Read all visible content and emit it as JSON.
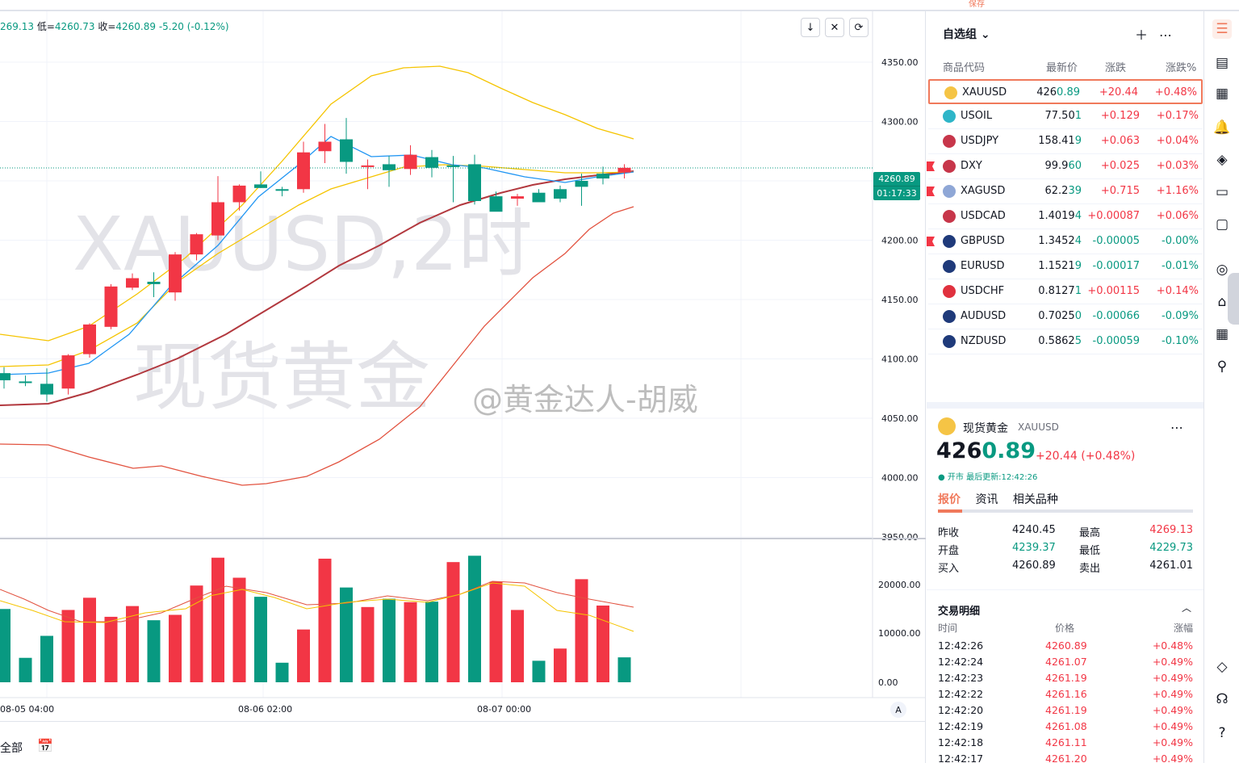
{
  "header": {
    "ohlc_text_prefix": "269.13 ",
    "low_label": "低=",
    "low_value": "4260.73",
    "close_label": "收=",
    "close_value": "4260.89",
    "change": "-5.20 (-0.12%)",
    "save_label": "保存"
  },
  "chart_tools": [
    "↓",
    "✕",
    "⟳"
  ],
  "watermark": {
    "line1": "XAUUSD,2时",
    "line2": "现货黄金",
    "weibo": "@黄金达人-胡威"
  },
  "price_tag": {
    "price": "4260.89",
    "countdown": "01:17:33"
  },
  "colors": {
    "up": "#f23645",
    "down": "#089981",
    "accent": "#f0795b",
    "ma_blue": "#2196f3",
    "ma_yellow": "#f5c400",
    "ma_red": "#b2383e",
    "band_red": "#e2523f"
  },
  "chart_data": {
    "type": "candlestick",
    "title": "XAUUSD,2时",
    "ylim": [
      3950,
      4350
    ],
    "y_ticks": [
      "4350.00",
      "4300.00",
      "4250.00",
      "4200.00",
      "4150.00",
      "4100.00",
      "4050.00",
      "4000.00",
      "3950.00"
    ],
    "x_ticks": [
      "08-05 04:00",
      "08-06 02:00",
      "08-07 00:00"
    ],
    "candles": [
      {
        "o": 4088,
        "h": 4093,
        "l": 4075,
        "c": 4082
      },
      {
        "o": 4081,
        "h": 4086,
        "l": 4077,
        "c": 4080
      },
      {
        "o": 4079,
        "h": 4092,
        "l": 4064,
        "c": 4070
      },
      {
        "o": 4075,
        "h": 4104,
        "l": 4070,
        "c": 4103
      },
      {
        "o": 4104,
        "h": 4130,
        "l": 4101,
        "c": 4129
      },
      {
        "o": 4127,
        "h": 4163,
        "l": 4125,
        "c": 4161
      },
      {
        "o": 4160,
        "h": 4172,
        "l": 4158,
        "c": 4168
      },
      {
        "o": 4165,
        "h": 4173,
        "l": 4152,
        "c": 4163
      },
      {
        "o": 4156,
        "h": 4190,
        "l": 4149,
        "c": 4188
      },
      {
        "o": 4188,
        "h": 4206,
        "l": 4183,
        "c": 4205
      },
      {
        "o": 4204,
        "h": 4254,
        "l": 4200,
        "c": 4232
      },
      {
        "o": 4232,
        "h": 4247,
        "l": 4225,
        "c": 4246
      },
      {
        "o": 4247,
        "h": 4258,
        "l": 4244,
        "c": 4244
      },
      {
        "o": 4243,
        "h": 4245,
        "l": 4237,
        "c": 4242
      },
      {
        "o": 4243,
        "h": 4283,
        "l": 4240,
        "c": 4274
      },
      {
        "o": 4275,
        "h": 4298,
        "l": 4265,
        "c": 4283
      },
      {
        "o": 4285,
        "h": 4303,
        "l": 4256,
        "c": 4266
      },
      {
        "o": 4262,
        "h": 4268,
        "l": 4243,
        "c": 4263
      },
      {
        "o": 4264,
        "h": 4271,
        "l": 4245,
        "c": 4259
      },
      {
        "o": 4260,
        "h": 4280,
        "l": 4255,
        "c": 4272
      },
      {
        "o": 4270,
        "h": 4276,
        "l": 4253,
        "c": 4261
      },
      {
        "o": 4263,
        "h": 4271,
        "l": 4232,
        "c": 4262
      },
      {
        "o": 4264,
        "h": 4272,
        "l": 4230,
        "c": 4233
      },
      {
        "o": 4237,
        "h": 4241,
        "l": 4225,
        "c": 4224
      },
      {
        "o": 4235,
        "h": 4239,
        "l": 4229,
        "c": 4237
      },
      {
        "o": 4240,
        "h": 4243,
        "l": 4234,
        "c": 4232
      },
      {
        "o": 4243,
        "h": 4246,
        "l": 4232,
        "c": 4235
      },
      {
        "o": 4250,
        "h": 4256,
        "l": 4229,
        "c": 4245
      },
      {
        "o": 4256,
        "h": 4262,
        "l": 4247,
        "c": 4252
      },
      {
        "o": 4257,
        "h": 4264,
        "l": 4252,
        "c": 4261
      }
    ],
    "volume_ticks": [
      "20000.00",
      "10000.00",
      "0.00"
    ],
    "volumes": [
      {
        "v": 15000,
        "up": false
      },
      {
        "v": 5000,
        "up": false
      },
      {
        "v": 9500,
        "up": false
      },
      {
        "v": 14800,
        "up": true
      },
      {
        "v": 17300,
        "up": true
      },
      {
        "v": 13400,
        "up": true
      },
      {
        "v": 15600,
        "up": true
      },
      {
        "v": 12700,
        "up": false
      },
      {
        "v": 13800,
        "up": true
      },
      {
        "v": 19800,
        "up": true
      },
      {
        "v": 25500,
        "up": true
      },
      {
        "v": 21400,
        "up": true
      },
      {
        "v": 17500,
        "up": false
      },
      {
        "v": 4000,
        "up": false
      },
      {
        "v": 10800,
        "up": true
      },
      {
        "v": 25300,
        "up": true
      },
      {
        "v": 19400,
        "up": false
      },
      {
        "v": 15400,
        "up": true
      },
      {
        "v": 17100,
        "up": false
      },
      {
        "v": 16400,
        "up": true
      },
      {
        "v": 16500,
        "up": false
      },
      {
        "v": 24600,
        "up": true
      },
      {
        "v": 25900,
        "up": false
      },
      {
        "v": 20600,
        "up": true
      },
      {
        "v": 14800,
        "up": true
      },
      {
        "v": 4400,
        "up": false
      },
      {
        "v": 6900,
        "up": true
      },
      {
        "v": 21100,
        "up": true
      },
      {
        "v": 15700,
        "up": true
      },
      {
        "v": 5100,
        "up": false
      }
    ]
  },
  "watchlist": {
    "title": "自选组",
    "columns": [
      "商品代码",
      "最新价",
      "涨跌",
      "涨跌%"
    ],
    "rows": [
      {
        "symbol": "XAUUSD",
        "last_a": "426",
        "last_b": "0.89",
        "chg": "+20.44",
        "pct": "+0.48%",
        "dir": "up",
        "icon": "gold-icon",
        "icon_color": "#f5c445",
        "flag": false,
        "selected": true
      },
      {
        "symbol": "USOIL",
        "last_a": "77.50",
        "last_b": "1",
        "chg": "+0.129",
        "pct": "+0.17%",
        "dir": "up",
        "icon": "oil-icon",
        "icon_color": "#2eb5c8",
        "flag": false,
        "selected": false
      },
      {
        "symbol": "USDJPY",
        "last_a": "158.41",
        "last_b": "9",
        "chg": "+0.063",
        "pct": "+0.04%",
        "dir": "up",
        "icon": "us-flag-icon",
        "icon_color": "#c7364a",
        "flag": false,
        "selected": false
      },
      {
        "symbol": "DXY",
        "last_a": "99.9",
        "last_b": "60",
        "chg": "+0.025",
        "pct": "+0.03%",
        "dir": "up",
        "icon": "us-flag-icon",
        "icon_color": "#c7364a",
        "flag": true,
        "selected": false
      },
      {
        "symbol": "XAGUSD",
        "last_a": "62.2",
        "last_b": "39",
        "chg": "+0.715",
        "pct": "+1.16%",
        "dir": "up",
        "icon": "silver-icon",
        "icon_color": "#8fa7d6",
        "flag": true,
        "selected": false
      },
      {
        "symbol": "USDCAD",
        "last_a": "1.4019",
        "last_b": "4",
        "chg": "+0.00087",
        "pct": "+0.06%",
        "dir": "up",
        "icon": "us-flag-icon",
        "icon_color": "#c7364a",
        "flag": false,
        "selected": false
      },
      {
        "symbol": "GBPUSD",
        "last_a": "1.3452",
        "last_b": "4",
        "chg": "-0.00005",
        "pct": "-0.00%",
        "dir": "dn",
        "icon": "uk-flag-icon",
        "icon_color": "#1f3a7a",
        "flag": true,
        "selected": false
      },
      {
        "symbol": "EURUSD",
        "last_a": "1.1521",
        "last_b": "9",
        "chg": "-0.00017",
        "pct": "-0.01%",
        "dir": "dn",
        "icon": "eu-flag-icon",
        "icon_color": "#1f3a7a",
        "flag": false,
        "selected": false
      },
      {
        "symbol": "USDCHF",
        "last_a": "0.8127",
        "last_b": "1",
        "chg": "+0.00115",
        "pct": "+0.14%",
        "dir": "up",
        "icon": "swiss-flag-icon",
        "icon_color": "#e0313e",
        "flag": false,
        "selected": false
      },
      {
        "symbol": "AUDUSD",
        "last_a": "0.7025",
        "last_b": "0",
        "chg": "-0.00066",
        "pct": "-0.09%",
        "dir": "dn",
        "icon": "au-flag-icon",
        "icon_color": "#1f3a7a",
        "flag": false,
        "selected": false
      },
      {
        "symbol": "NZDUSD",
        "last_a": "0.5862",
        "last_b": "5",
        "chg": "-0.00059",
        "pct": "-0.10%",
        "dir": "dn",
        "icon": "nz-flag-icon",
        "icon_color": "#1f3a7a",
        "flag": false,
        "selected": false
      }
    ]
  },
  "details": {
    "name": "现货黄金",
    "symbol": "XAUUSD",
    "price_a": "426",
    "price_b": "0.89",
    "change": "+20.44 (+0.48%)",
    "status": "● 开市 最后更新:12:42:26",
    "tabs": [
      "报价",
      "资讯",
      "相关品种"
    ],
    "stats": [
      {
        "label": "昨收",
        "value": "4240.45",
        "label2": "最高",
        "value2": "4269.13",
        "v1c": "#131722",
        "v2c": "#f23645"
      },
      {
        "label": "开盘",
        "value": "4239.37",
        "label2": "最低",
        "value2": "4229.73",
        "v1c": "#089981",
        "v2c": "#089981"
      },
      {
        "label": "买入",
        "value": "4260.89",
        "label2": "卖出",
        "value2": "4261.01",
        "v1c": "#131722",
        "v2c": "#131722"
      }
    ],
    "trades_title": "交易明细",
    "trades_columns": [
      "时间",
      "价格",
      "涨幅"
    ],
    "trades": [
      {
        "time": "12:42:26",
        "price": "4260.89",
        "pct": "+0.48%"
      },
      {
        "time": "12:42:24",
        "price": "4261.07",
        "pct": "+0.49%"
      },
      {
        "time": "12:42:23",
        "price": "4261.19",
        "pct": "+0.49%"
      },
      {
        "time": "12:42:22",
        "price": "4261.16",
        "pct": "+0.49%"
      },
      {
        "time": "12:42:20",
        "price": "4261.19",
        "pct": "+0.49%"
      },
      {
        "time": "12:42:19",
        "price": "4261.08",
        "pct": "+0.49%"
      },
      {
        "time": "12:42:18",
        "price": "4261.11",
        "pct": "+0.49%"
      },
      {
        "time": "12:42:17",
        "price": "4261.20",
        "pct": "+0.49%"
      }
    ]
  },
  "bottom_bar": {
    "all_label": "全部"
  },
  "side_toolbar": [
    "watchlist-icon",
    "notes-icon",
    "calendar-icon",
    "alert-icon",
    "layers-icon",
    "video-icon",
    "chat-icon",
    "target-icon",
    "education-icon",
    "table-icon",
    "network-icon",
    "diamond-icon",
    "headset-icon",
    "help-icon"
  ]
}
